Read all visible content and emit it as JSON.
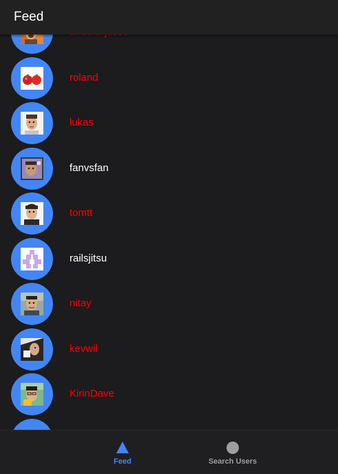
{
  "header": {
    "title": "Feed"
  },
  "colors": {
    "accent": "#4286f5",
    "followed_user": "#ff0000",
    "other_user": "#ffffff",
    "inactive_tab": "#9e9e9e"
  },
  "users": [
    {
      "name": "anotherjesse",
      "followed": true,
      "avatar": "jesse"
    },
    {
      "name": "roland",
      "followed": true,
      "avatar": "tomatoes"
    },
    {
      "name": "lukas",
      "followed": true,
      "avatar": "face-light"
    },
    {
      "name": "fanvsfan",
      "followed": false,
      "avatar": "face-framed"
    },
    {
      "name": "tomtt",
      "followed": true,
      "avatar": "face-dark-hair"
    },
    {
      "name": "railsjitsu",
      "followed": false,
      "avatar": "identicon"
    },
    {
      "name": "nitay",
      "followed": true,
      "avatar": "face-outdoor"
    },
    {
      "name": "kevwil",
      "followed": true,
      "avatar": "face-side"
    },
    {
      "name": "KirinDave",
      "followed": true,
      "avatar": "face-glasses"
    }
  ],
  "tabs": [
    {
      "label": "Feed",
      "icon": "triangle-icon",
      "active": true
    },
    {
      "label": "Search Users",
      "icon": "circle-icon",
      "active": false
    }
  ]
}
